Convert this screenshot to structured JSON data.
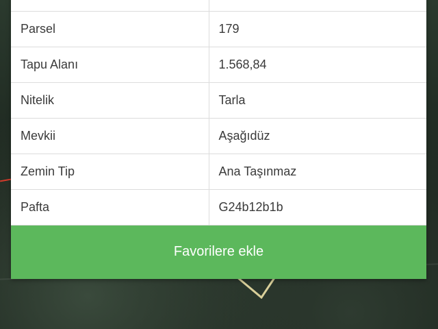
{
  "parcel_table": {
    "rows": [
      {
        "label": "Parsel",
        "value": "179"
      },
      {
        "label": "Tapu Alanı",
        "value": "1.568,84"
      },
      {
        "label": "Nitelik",
        "value": "Tarla"
      },
      {
        "label": "Mevkii",
        "value": "Aşağıdüz"
      },
      {
        "label": "Zemin Tip",
        "value": "Ana Taşınmaz"
      },
      {
        "label": "Pafta",
        "value": "G24b12b1b"
      }
    ]
  },
  "actions": {
    "favorite_label": "Favorilere ekle"
  },
  "colors": {
    "button": "#5cb85c",
    "marker": "#d9cf9a"
  },
  "icons": {
    "parcel_marker": "parcel-outline-icon"
  }
}
